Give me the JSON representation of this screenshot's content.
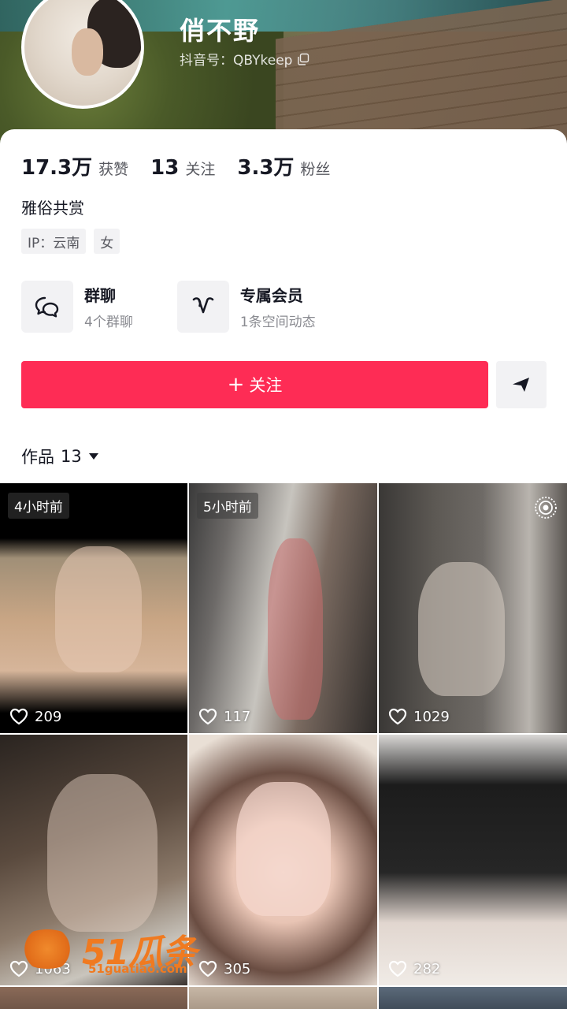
{
  "profile": {
    "name": "俏不野",
    "id_label": "抖音号：QBYkeep"
  },
  "stats": [
    {
      "value": "17.3万",
      "label": "获赞"
    },
    {
      "value": "13",
      "label": "关注"
    },
    {
      "value": "3.3万",
      "label": "粉丝"
    }
  ],
  "bio": "雅俗共赏",
  "tags": [
    "IP：云南",
    "女"
  ],
  "features": [
    {
      "title": "群聊",
      "subtitle": "4个群聊",
      "icon": "chat-bubbles-icon"
    },
    {
      "title": "专属会员",
      "subtitle": "1条空间动态",
      "icon": "vip-heart-icon"
    }
  ],
  "actions": {
    "follow_plus": "+",
    "follow_label": "关注",
    "share_icon": "send-icon"
  },
  "works": {
    "label": "作品",
    "count": "13"
  },
  "videos": [
    {
      "time": "4小时前",
      "likes": "209"
    },
    {
      "time": "5小时前",
      "likes": "117"
    },
    {
      "time": "",
      "likes": "1029",
      "badge_icon": "live-photo-icon"
    },
    {
      "time": "",
      "likes": "1063"
    },
    {
      "time": "",
      "likes": "305"
    },
    {
      "time": "",
      "likes": "282"
    }
  ],
  "watermark": {
    "brand": "51瓜条",
    "url": "51guatiao.com"
  },
  "colors": {
    "accent": "#fe2c55",
    "text": "#161823",
    "muted": "#8a8b91",
    "tag_bg": "#f2f2f4"
  }
}
